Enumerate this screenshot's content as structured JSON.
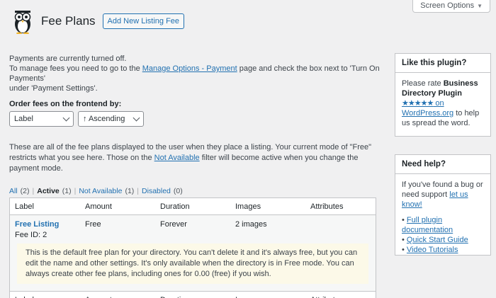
{
  "screen_options": {
    "label": "Screen Options"
  },
  "header": {
    "title": "Fee Plans",
    "add_button": "Add New Listing Fee"
  },
  "notice": {
    "line1": "Payments are currently turned off.",
    "line2_prefix": "To manage fees you need to go to the ",
    "line2_link": "Manage Options - Payment",
    "line2_suffix": " page and check the box next to 'Turn On Payments'",
    "line3": "under 'Payment Settings'."
  },
  "order": {
    "label": "Order fees on the frontend by:",
    "sort_field": "Label",
    "sort_direction": "↑ Ascending"
  },
  "description": {
    "prefix": "These are all of the fee plans displayed to the user when they place a listing. Your current mode of \"Free\" restricts what you see here. Those on the ",
    "link": "Not Available",
    "suffix": " filter will become active when you change the payment mode."
  },
  "filters": [
    {
      "label": "All",
      "count": "(2)"
    },
    {
      "label": "Active",
      "count": "(1)"
    },
    {
      "label": "Not Available",
      "count": "(1)"
    },
    {
      "label": "Disabled",
      "count": "(0)"
    }
  ],
  "table": {
    "columns": [
      "Label",
      "Amount",
      "Duration",
      "Images",
      "Attributes"
    ],
    "row": {
      "label": "Free Listing",
      "fee_id_label": "Fee ID:",
      "fee_id": "2",
      "amount": "Free",
      "duration": "Forever",
      "images": "2 images",
      "note": "This is the default free plan for your directory. You can't delete it and it's always free, but you can edit the name and other settings. It's only available when the directory is in Free mode. You can always create other fee plans, including ones for 0.00 (free) if you wish."
    }
  },
  "sidebar": {
    "like": {
      "title": "Like this plugin?",
      "text_prefix": "Please rate ",
      "plugin_name": "Business Directory Plugin",
      "stars": "★★★★★",
      "link_text": " on WordPress.org",
      "text_suffix": " to help us spread the word."
    },
    "help": {
      "title": "Need help?",
      "text": "If you've found a bug or need support ",
      "link": "let us know!",
      "links": [
        "Full plugin documentation",
        "Quick Start Guide",
        "Video Tutorials"
      ]
    }
  }
}
